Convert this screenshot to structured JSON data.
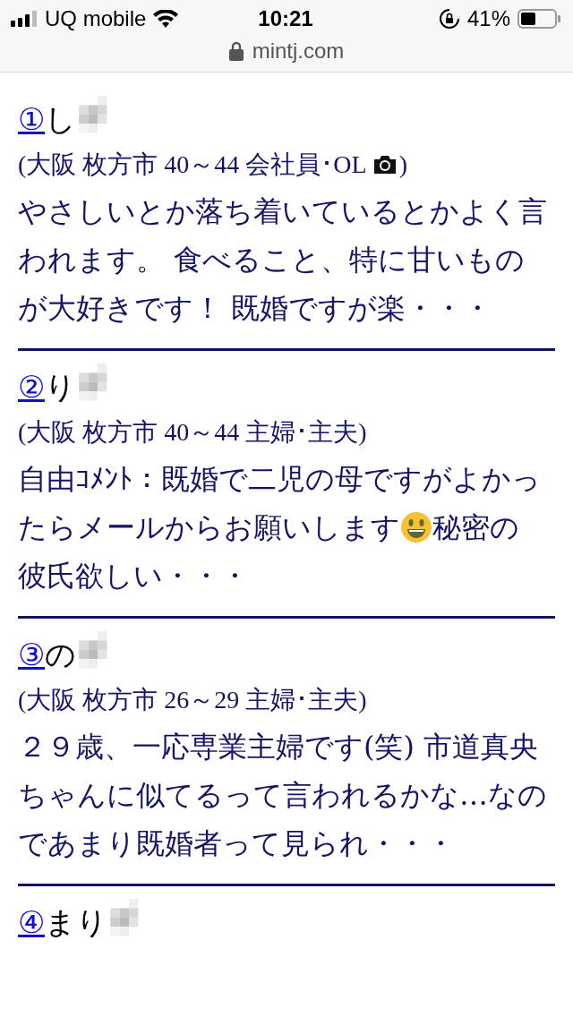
{
  "status_bar": {
    "carrier": "UQ mobile",
    "time": "10:21",
    "battery": "41%"
  },
  "address_bar": {
    "url": "mintj.com"
  },
  "entries": [
    {
      "number": "①",
      "name": "し",
      "meta": [
        {
          "kind": "text",
          "text": "(大阪 枚方市 40～44 会社員･OL"
        },
        {
          "kind": "camera"
        },
        {
          "kind": "text",
          "text": ")"
        }
      ],
      "description": [
        [
          {
            "kind": "text",
            "text": "やさしいとか落ち着いているとかよく言"
          }
        ],
        [
          {
            "kind": "text",
            "text": "われます。 食べること、特に甘いもの"
          }
        ],
        [
          {
            "kind": "text",
            "text": "が大好きです！ 既婚ですが楽・・・"
          }
        ]
      ]
    },
    {
      "number": "②",
      "name": "り",
      "meta": [
        {
          "kind": "text",
          "text": "(大阪 枚方市 40～44 主婦･主夫)"
        }
      ],
      "description": [
        [
          {
            "kind": "text",
            "text": "自由ｺﾒﾝﾄ：既婚で二児の母ですがよかっ"
          }
        ],
        [
          {
            "kind": "text",
            "text": "たらメールからお願いします"
          },
          {
            "kind": "emoji"
          },
          {
            "kind": "text",
            "text": "秘密の"
          }
        ],
        [
          {
            "kind": "text",
            "text": "彼氏欲しい・・・"
          }
        ]
      ]
    },
    {
      "number": "③",
      "name": "の",
      "meta": [
        {
          "kind": "text",
          "text": "(大阪 枚方市 26～29 主婦･主夫)"
        }
      ],
      "description": [
        [
          {
            "kind": "text",
            "text": "２９歳、一応専業主婦です(笑) 市道真央"
          }
        ],
        [
          {
            "kind": "text",
            "text": "ちゃんに似てるって言われるかな…なの"
          }
        ],
        [
          {
            "kind": "text",
            "text": "であまり既婚者って見られ・・・"
          }
        ]
      ]
    },
    {
      "number": "④",
      "name": "まり"
    }
  ]
}
